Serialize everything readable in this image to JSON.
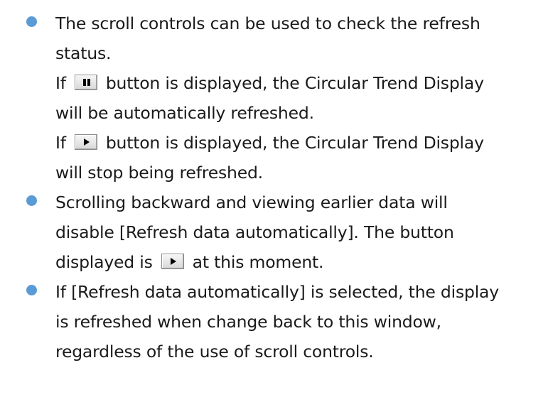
{
  "bullet_color": "#5b9bd5",
  "bullets": [
    {
      "lines": [
        "The scroll controls can be used to check the refresh",
        "status."
      ],
      "pause_line": {
        "prefix": "If",
        "button_icon": "pause-icon",
        "suffix": "button is displayed, the Circular Trend Display"
      },
      "pause_line_2": "will be automatically refreshed.",
      "play_line": {
        "prefix": "If",
        "button_icon": "play-icon",
        "suffix": "button is displayed, the Circular Trend Display"
      },
      "play_line_2": "will stop being refreshed."
    },
    {
      "lines": [
        "Scrolling backward and viewing earlier data will",
        "disable [Refresh data automatically]. The button"
      ],
      "icon_line": {
        "prefix": "displayed is",
        "button_icon": "play-icon",
        "suffix": "at this moment."
      }
    },
    {
      "lines": [
        "If [Refresh data automatically] is selected, the display",
        "is refreshed when change back to this window,",
        "regardless of the use of scroll controls."
      ]
    }
  ]
}
